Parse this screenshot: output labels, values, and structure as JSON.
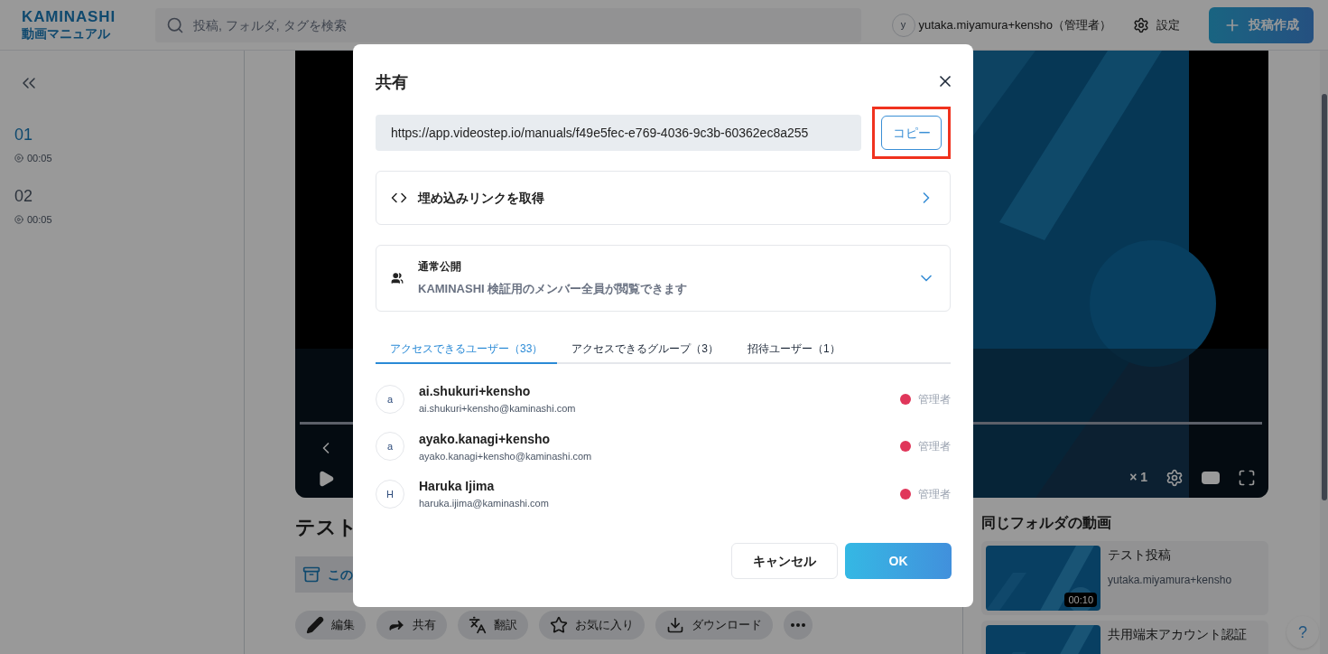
{
  "header": {
    "logo": {
      "brand": "KAMINASHI",
      "product": "動画マニュアル"
    },
    "search": {
      "placeholder": "投稿, フォルダ, タグを検索"
    },
    "user": {
      "avatar": "y",
      "name": "yutaka.miyamura+kensho（管理者）"
    },
    "settings": "設定",
    "create_button": "投稿作成"
  },
  "sidebar": {
    "items": [
      {
        "number": "01",
        "duration": "00:05",
        "selected": true
      },
      {
        "number": "02",
        "duration": "00:05",
        "selected": false
      }
    ]
  },
  "video": {
    "speed": "× 1"
  },
  "post": {
    "title": "テスト",
    "folder_link": "この",
    "actions": [
      {
        "kind": "edit",
        "label": "編集"
      },
      {
        "kind": "share",
        "label": "共有"
      },
      {
        "kind": "translate",
        "label": "翻訳"
      },
      {
        "kind": "favorite",
        "label": "お気に入り"
      },
      {
        "kind": "download",
        "label": "ダウンロード"
      },
      {
        "kind": "more"
      }
    ]
  },
  "related": {
    "heading": "同じフォルダの動画",
    "items": [
      {
        "title": "テスト投稿",
        "author": "yutaka.miyamura+kensho",
        "duration": "00:10"
      },
      {
        "title": "共用端末アカウント認証"
      }
    ]
  },
  "help": "?",
  "dialog": {
    "title": "共有",
    "url": "https://app.videostep.io/manuals/f49e5fec-e769-4036-9c3b-60362ec8a255",
    "copy_button": {
      "label": "コピー",
      "highlighted": true
    },
    "embed_label": "埋め込みリンクを取得",
    "visibility": {
      "title": "通常公開",
      "description": "KAMINASHI 検証用のメンバー全員が閲覧できます"
    },
    "tabs": [
      {
        "label": "アクセスできるユーザー（33）",
        "selected": true
      },
      {
        "label": "アクセスできるグループ（3）",
        "selected": false
      },
      {
        "label": "招待ユーザー（1）",
        "selected": false
      }
    ],
    "users": [
      {
        "avatar": "a",
        "name": "ai.shukuri+kensho",
        "email": "ai.shukuri+kensho@kaminashi.com",
        "role": "管理者",
        "color": "#e0365a"
      },
      {
        "avatar": "a",
        "name": "ayako.kanagi+kensho",
        "email": "ayako.kanagi+kensho@kaminashi.com",
        "role": "管理者",
        "color": "#e0365a"
      },
      {
        "avatar": "H",
        "name": "Haruka Ijima",
        "email": "haruka.ijima@kaminashi.com",
        "role": "管理者",
        "color": "#e0365a"
      }
    ],
    "cancel_button": "キャンセル",
    "ok_button": "OK"
  }
}
